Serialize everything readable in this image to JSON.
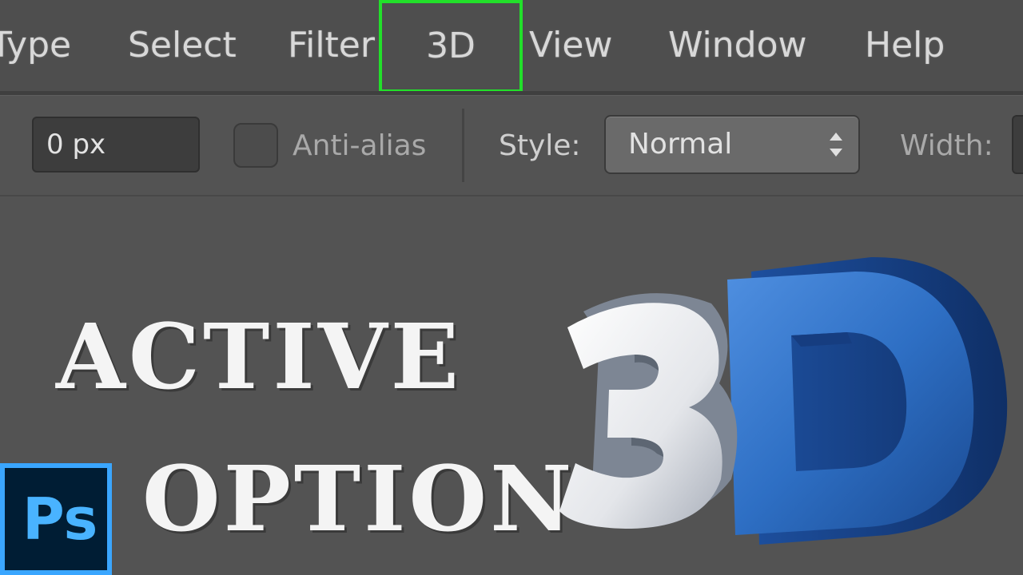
{
  "menu": {
    "items": [
      {
        "label": "Type"
      },
      {
        "label": "Select"
      },
      {
        "label": "Filter"
      },
      {
        "label": "3D",
        "highlighted": true
      },
      {
        "label": "View"
      },
      {
        "label": "Window"
      },
      {
        "label": "Help"
      }
    ],
    "highlight_color": "#22e02a"
  },
  "options": {
    "feather_label": ":",
    "feather_value": "0 px",
    "antialias_label": "Anti-alias",
    "antialias_checked": false,
    "style_label": "Style:",
    "style_value": "Normal",
    "width_label": "Width:"
  },
  "headline": {
    "line1": "ACTIVE",
    "line2": "OPTION"
  },
  "logo": {
    "text": "Ps",
    "border_color": "#3aa6ff",
    "background": "#001d34"
  },
  "art": {
    "text": "3D",
    "three_color": "#f0f0f0",
    "d_color": "#2e6fc4"
  }
}
